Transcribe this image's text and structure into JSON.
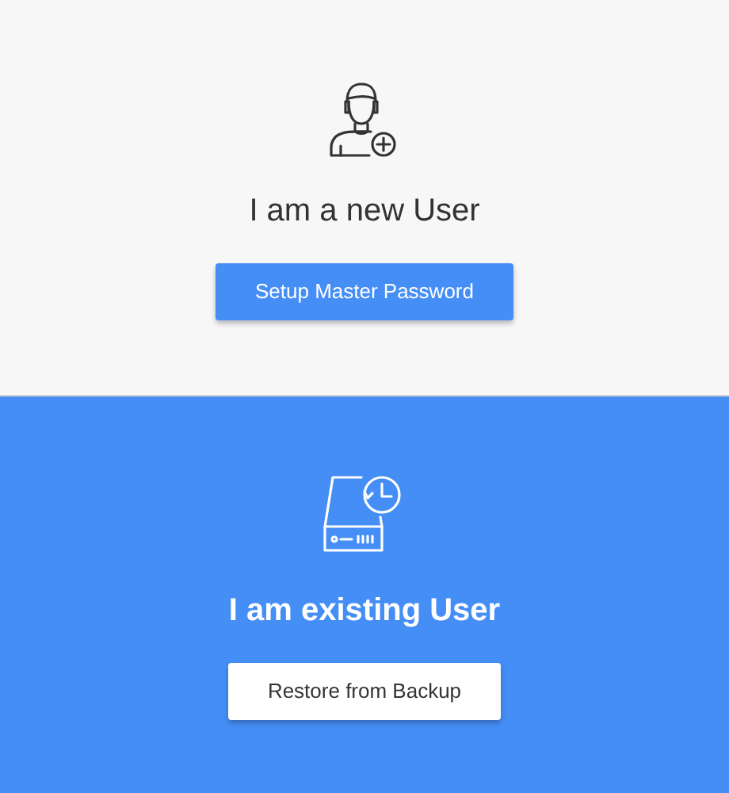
{
  "sections": [
    {
      "kind": "new_user",
      "title": "I am a new User",
      "button": "Setup Master Password"
    },
    {
      "kind": "existing_user",
      "title": "I am existing User",
      "button": "Restore from Backup"
    }
  ]
}
